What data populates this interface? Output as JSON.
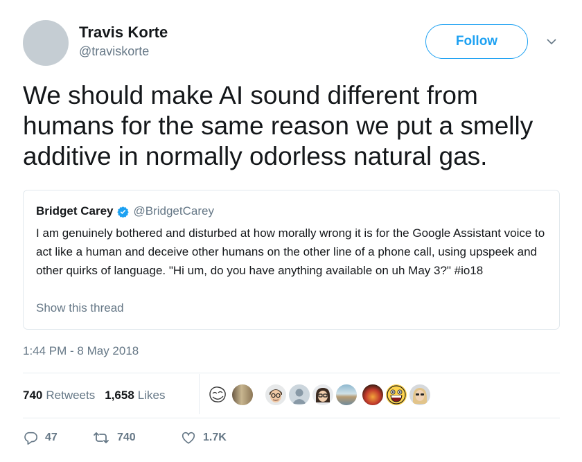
{
  "tweet": {
    "author": {
      "name": "Travis Korte",
      "handle": "@traviskorte"
    },
    "follow_label": "Follow",
    "text": "We should make AI sound different from humans for the same reason we put a smelly additive in normally odorless natural gas.",
    "quoted": {
      "name": "Bridget Carey",
      "handle": "@BridgetCarey",
      "text": "I am genuinely bothered and disturbed at how morally wrong it is for the Google Assistant voice to act like a human and deceive other humans on the other line of a phone call, using upspeek and other quirks of language. \"Hi um, do you have anything available on uh May 3?\" #io18",
      "show_thread": "Show this thread"
    },
    "timestamp": "1:44 PM - 8 May 2018",
    "stats": {
      "retweets_count": "740",
      "retweets_label": "Retweets",
      "likes_count": "1,658",
      "likes_label": "Likes"
    },
    "actions": {
      "replies": "47",
      "retweets": "740",
      "likes": "1.7K"
    }
  },
  "colors": {
    "accent": "#1da1f2",
    "secondary_text": "#657786",
    "border": "#e1e8ed"
  },
  "liker_avatars": [
    "troll-face",
    "tree",
    "glasses-man",
    "default-person",
    "glasses-girl",
    "beach",
    "fire",
    "grin-face",
    "woman"
  ]
}
